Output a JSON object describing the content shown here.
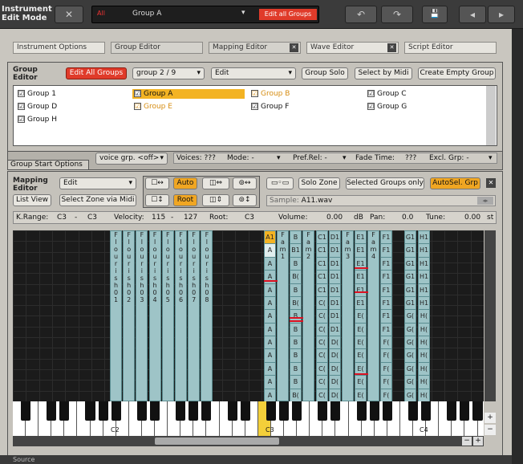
{
  "app": {
    "title_line1": "Instrument",
    "title_line2": "Edit Mode"
  },
  "toolbar": {
    "close_glyph": "✕",
    "group_prefix": "All",
    "group_name": "Group A",
    "edit_all_label": "Edit all Groups",
    "undo_glyph": "↶",
    "redo_glyph": "↷",
    "save_glyph": "💾",
    "prev_glyph": "◂",
    "next_glyph": "▸"
  },
  "tabs": [
    {
      "label": "Instrument Options"
    },
    {
      "label": "Group Editor"
    },
    {
      "label": "Mapping Editor"
    },
    {
      "label": "Wave Editor"
    },
    {
      "label": "Script Editor"
    }
  ],
  "group_editor": {
    "title_line1": "Group",
    "title_line2": "Editor",
    "edit_all_label": "Edit All Groups",
    "group_counter": "group 2 / 9",
    "edit_menu": "Edit",
    "group_solo": "Group Solo",
    "select_by_midi": "Select by Midi",
    "create_empty": "Create Empty Group",
    "groups": [
      {
        "name": "Group 1",
        "checked": "☑"
      },
      {
        "name": "Group A",
        "checked": "☑"
      },
      {
        "name": "Group B",
        "checked": "☑"
      },
      {
        "name": "Group C",
        "checked": "☑"
      },
      {
        "name": "Group D",
        "checked": "☑"
      },
      {
        "name": "Group E",
        "checked": "☑"
      },
      {
        "name": "Group F",
        "checked": "☑"
      },
      {
        "name": "Group G",
        "checked": "☑"
      },
      {
        "name": "Group H",
        "checked": "☑"
      }
    ],
    "start_options": "Group Start Options",
    "voice_grp": "voice grp. <off>",
    "voices_label": "Voices:",
    "voices_value": "???",
    "mode_label": "Mode:",
    "mode_value": "-",
    "pref_rel_label": "Pref.Rel:",
    "pref_rel_value": "-",
    "fade_label": "Fade Time:",
    "fade_value": "???",
    "excl_label": "Excl. Grp:",
    "excl_value": "-"
  },
  "mapping": {
    "title_line1": "Mapping",
    "title_line2": "Editor",
    "edit_menu": "Edit",
    "list_view": "List View",
    "select_zone_midi": "Select Zone via Midi",
    "auto": "Auto",
    "root": "Root",
    "solo_zone": "Solo Zone",
    "selected_groups_only": "Selected Groups only",
    "autosel": "AutoSel. Grp",
    "sample_label": "Sample:",
    "sample_value": "A11.wav",
    "krange_label": "K.Range:",
    "krange_lo": "C3",
    "krange_dash": "-",
    "krange_hi": "C3",
    "vel_label": "Velocity:",
    "vel_lo": "115",
    "vel_dash": "-",
    "vel_hi": "127",
    "root_label": "Root:",
    "root_value": "C3",
    "volume_label": "Volume:",
    "volume_value": "0.00",
    "volume_unit": "dB",
    "pan_label": "Pan:",
    "pan_value": "0.0",
    "tune_label": "Tune:",
    "tune_value": "0.00",
    "tune_unit": "st"
  },
  "zones_group1": [
    "F l o u r i s h 0 1",
    "F l o u r i s h 0 2",
    "F l o u r i s h 0 3",
    "F l o u r i s h 0 4",
    "F l o u r i s h 0 5",
    "F l o u r i s h 0 6",
    "F l o u r i s h 0 7",
    "F l o u r i s h 0 8"
  ],
  "zones_mid": [
    {
      "cells": [
        "A1",
        "A",
        "A",
        "A",
        "A",
        "A",
        "A",
        "A",
        "A",
        "A",
        "A",
        "A",
        "A"
      ]
    },
    {
      "cells": [
        "F",
        "a",
        "m",
        "1"
      ]
    },
    {
      "cells": [
        "B",
        "B1",
        "B",
        "B(",
        "B",
        "B(",
        "B",
        "B",
        "B",
        "B",
        "B",
        "B",
        "B("
      ]
    },
    {
      "cells": [
        "F",
        "a",
        "m",
        "2"
      ]
    },
    {
      "cells": [
        "C1",
        "C1",
        "C1",
        "C1",
        "C1",
        "C(",
        "C(",
        "C(",
        "C(",
        "C(",
        "C(",
        "C(",
        "C("
      ]
    },
    {
      "cells": [
        "D1",
        "D1",
        "D1",
        "D1",
        "D1",
        "D1",
        "D1",
        "D1",
        "D(",
        "D(",
        "D(",
        "D(",
        "D("
      ]
    },
    {
      "cells": [
        "F",
        "a",
        "m",
        "3"
      ]
    },
    {
      "cells": [
        "E1",
        "E1",
        "E1",
        "E1",
        "E1",
        "E1",
        "E(",
        "E(",
        "E(",
        "E(",
        "E(",
        "E(",
        "E("
      ]
    },
    {
      "cells": [
        "F",
        "a",
        "m",
        "4"
      ]
    },
    {
      "cells": [
        "F1",
        "F1",
        "F1",
        "F1",
        "F1",
        "F1",
        "F1",
        "F1",
        "F(",
        "F(",
        "F(",
        "F(",
        "F("
      ]
    },
    {
      "cells": [
        "G1",
        "G1",
        "G1",
        "G1",
        "G1",
        "G1",
        "G(",
        "G(",
        "G(",
        "G(",
        "G(",
        "G(",
        "G("
      ]
    },
    {
      "cells": [
        "H1",
        "H1",
        "H1",
        "H1",
        "H1",
        "H1",
        "H(",
        "H(",
        "H(",
        "H(",
        "H(",
        "H(",
        "H("
      ]
    }
  ],
  "piano": {
    "c2": "C2",
    "c3": "C3",
    "c4": "C4"
  },
  "bottom": {
    "label": "Source"
  }
}
